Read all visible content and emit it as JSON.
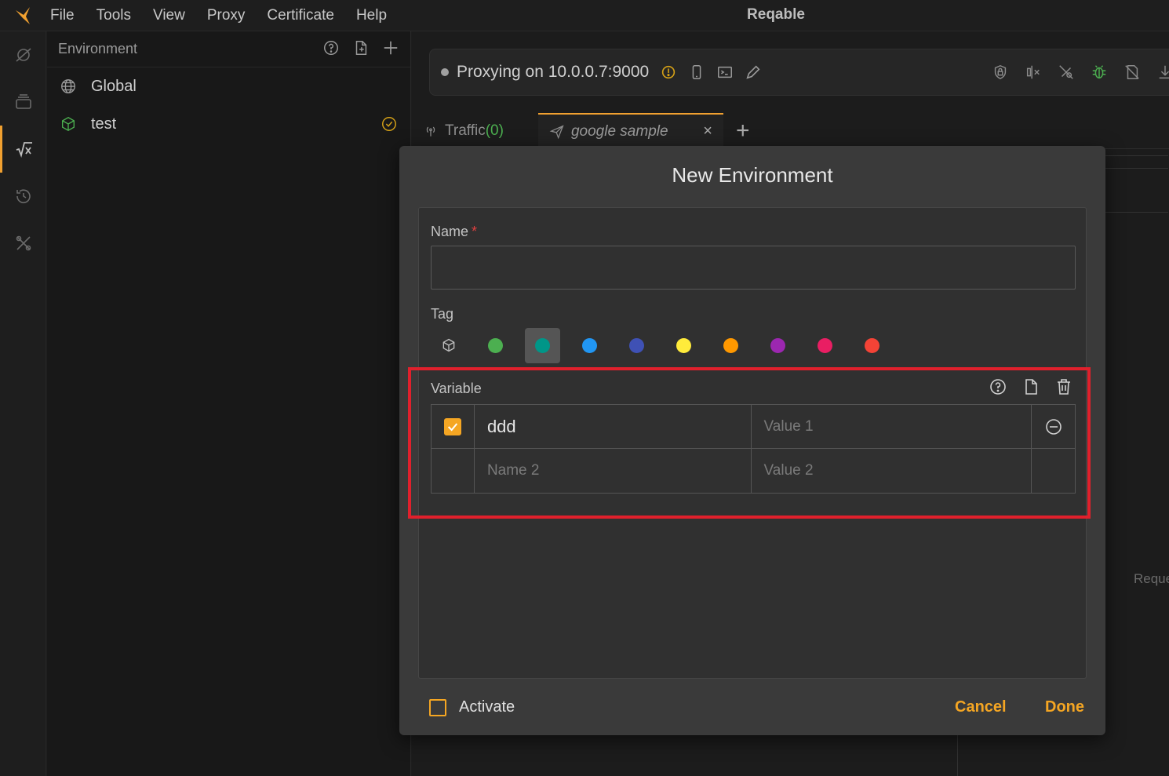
{
  "app": {
    "title": "Reqable"
  },
  "menu": [
    "File",
    "Tools",
    "View",
    "Proxy",
    "Certificate",
    "Help"
  ],
  "activity_icons": [
    "satellite-icon",
    "layers-icon",
    "formula-icon",
    "history-icon",
    "tools-icon"
  ],
  "sidebar": {
    "title": "Environment",
    "items": [
      {
        "label": "Global",
        "icon": "globe-icon"
      },
      {
        "label": "test",
        "icon": "cube-icon",
        "active": true
      }
    ]
  },
  "proxy": {
    "status": "Proxying on 10.0.0.7:9000"
  },
  "tabs": {
    "traffic_label": "Traffic",
    "traffic_count": "(0)",
    "active_label": "google sample",
    "close": "×",
    "add": "+"
  },
  "background": {
    "ghost_text": "Reque"
  },
  "dialog": {
    "title": "New Environment",
    "name_label": "Name",
    "required_mark": "*",
    "name_value": "",
    "tag_label": "Tag",
    "tag_colors": [
      "#4caf50",
      "#009688",
      "#2196f3",
      "#3f51b5",
      "#ffeb3b",
      "#ff9800",
      "#9c27b0",
      "#e91e63",
      "#f44336"
    ],
    "selected_tag_color": "#009688",
    "variable_label": "Variable",
    "variables": [
      {
        "enabled": true,
        "name": "ddd",
        "name_placeholder": "",
        "value": "",
        "value_placeholder": "Value 1"
      },
      {
        "enabled": false,
        "name": "",
        "name_placeholder": "Name 2",
        "value": "",
        "value_placeholder": "Value 2"
      }
    ],
    "activate_label": "Activate",
    "activate_checked": false,
    "cancel_label": "Cancel",
    "done_label": "Done"
  },
  "colors": {
    "accent": "#f5a623",
    "highlight": "#e0202c",
    "success": "#4caf50",
    "warning": "#d4a017"
  }
}
